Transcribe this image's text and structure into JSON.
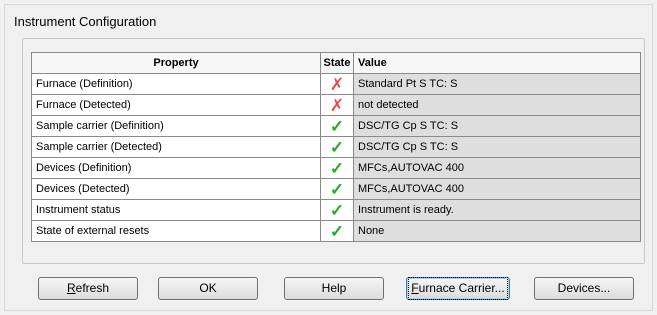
{
  "window": {
    "title": "Instrument Configuration"
  },
  "table": {
    "headers": {
      "property": "Property",
      "state": "State",
      "value": "Value"
    },
    "rows": [
      {
        "property": "Furnace (Definition)",
        "state_icon": "cross-icon",
        "value": "Standard Pt S TC: S"
      },
      {
        "property": "Furnace (Detected)",
        "state_icon": "cross-icon",
        "value": "not detected"
      },
      {
        "property": "Sample carrier (Definition)",
        "state_icon": "check-icon",
        "value": "DSC/TG Cp S TC: S"
      },
      {
        "property": "Sample carrier (Detected)",
        "state_icon": "check-icon",
        "value": "DSC/TG Cp S TC: S"
      },
      {
        "property": "Devices (Definition)",
        "state_icon": "check-icon",
        "value": "MFCs,AUTOVAC 400"
      },
      {
        "property": "Devices (Detected)",
        "state_icon": "check-icon",
        "value": "MFCs,AUTOVAC 400"
      },
      {
        "property": "Instrument status",
        "state_icon": "check-icon",
        "value": "Instrument is ready."
      },
      {
        "property": "State of external resets",
        "state_icon": "check-icon",
        "value": "None"
      }
    ]
  },
  "buttons": {
    "refresh_first": "R",
    "refresh_rest": "efresh",
    "ok": "OK",
    "help": "Help",
    "furnace_first": "F",
    "furnace_rest": "urnace Carrier...",
    "devices": "Devices..."
  },
  "colors": {
    "cross": "#e34b4b",
    "check": "#2ca82c",
    "value_cell_bg": "#dedede",
    "focus_border": "#3c7fb1"
  }
}
